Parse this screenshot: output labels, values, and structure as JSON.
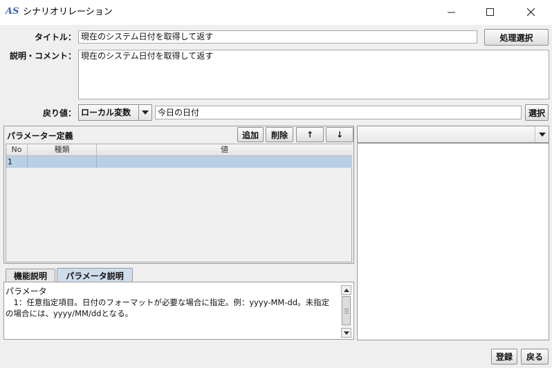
{
  "window": {
    "logo": "AS",
    "title": "シナリオリレーション"
  },
  "form": {
    "title_label": "タイトル：",
    "title_value": "現在のシステム日付を取得して返す",
    "select_process_button": "処理選択",
    "comment_label": "説明・コメント：",
    "comment_value": "現在のシステム日付を取得して返す",
    "return_label": "戻り値：",
    "return_type_selected": "ローカル変数",
    "return_value": "今日の日付",
    "select_button": "選択"
  },
  "params": {
    "title": "パラメーター定義",
    "add_button": "追加",
    "delete_button": "削除",
    "up_button": "↑",
    "down_button": "↓",
    "columns": [
      "No",
      "種類",
      "値"
    ],
    "rows": [
      {
        "no": "1",
        "type": "",
        "value": ""
      }
    ]
  },
  "help": {
    "tabs": [
      "機能説明",
      "パラメータ説明"
    ],
    "active_tab": "パラメータ説明",
    "lines": [
      "パラメータ",
      "　1：任意指定項目。日付のフォーマットが必要な場合に指定。例：yyyy-MM-dd。未指定",
      "の場合には、yyyy/MM/ddとなる。"
    ]
  },
  "right_panel": {
    "dropdown_value": ""
  },
  "footer": {
    "register_button": "登録",
    "back_button": "戻る"
  },
  "icons": {
    "minimize": "minimize-icon",
    "maximize": "maximize-icon",
    "close": "close-icon",
    "dropdown": "chevron-down-icon"
  },
  "colors": {
    "selection": "#b8cfe5",
    "window_bg": "#efefef",
    "logo": "#3b63b8"
  }
}
